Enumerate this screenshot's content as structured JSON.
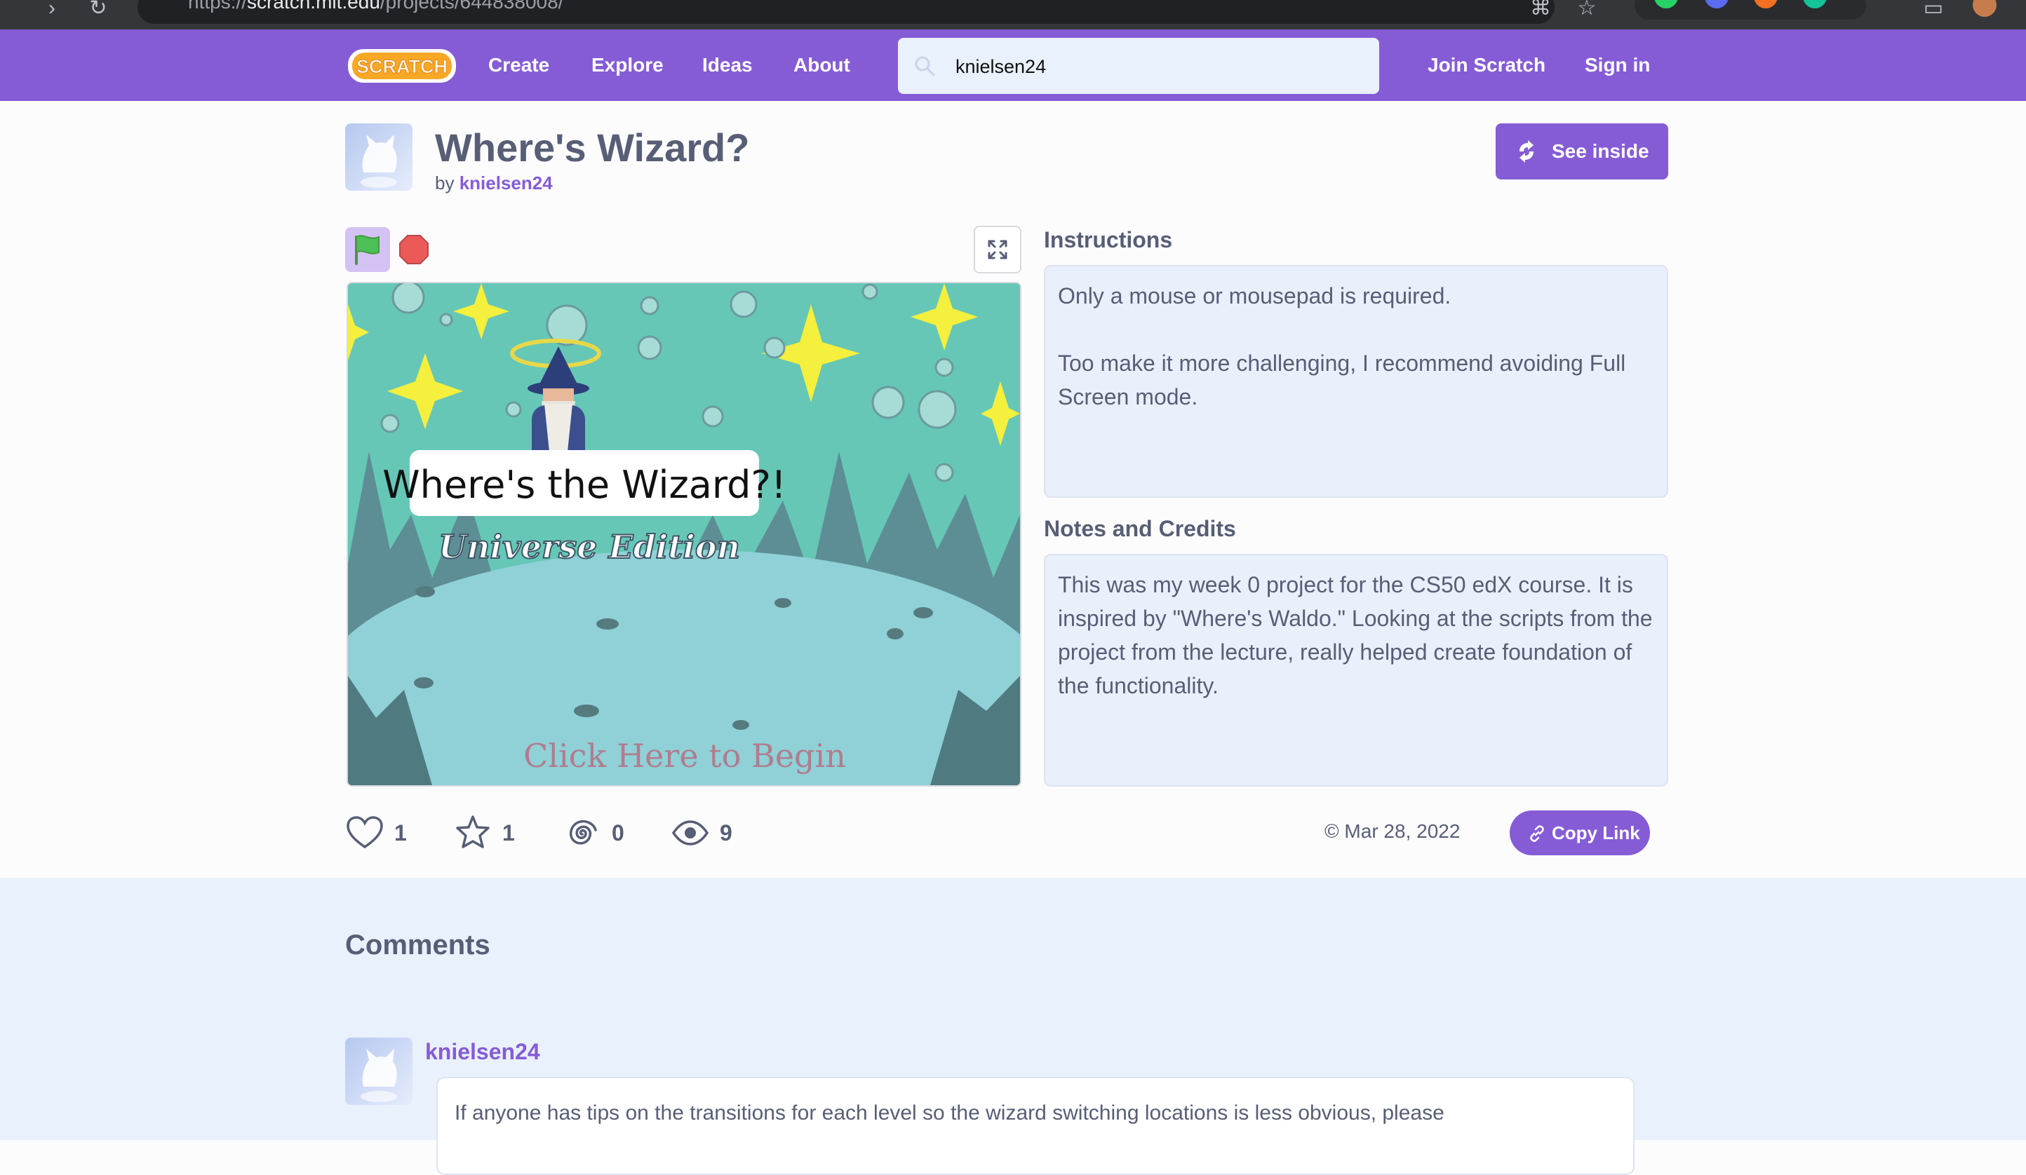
{
  "browser": {
    "url_prefix": "https://",
    "url_host": "scratch.mit.edu",
    "url_path": "/projects/644838008/"
  },
  "menubar": {
    "logo_text": "SCRATCH",
    "links": [
      "Create",
      "Explore",
      "Ideas",
      "About"
    ],
    "search_value": "knielsen24",
    "join_label": "Join Scratch",
    "signin_label": "Sign in",
    "brand_color": "#855cd6"
  },
  "project": {
    "title": "Where's Wizard?",
    "by_label": "by",
    "author": "knielsen24",
    "see_inside_label": "See inside"
  },
  "stage": {
    "title_text": "Where's the Wizard?!",
    "subtitle_text": "Universe Edition",
    "cta_text": "Click Here to Begin"
  },
  "instructions": {
    "heading": "Instructions",
    "paragraphs": [
      "Only a mouse or mousepad is required.",
      "Too make it more challenging, I recommend avoiding Full Screen mode."
    ]
  },
  "notes": {
    "heading": "Notes and Credits",
    "text": "This was my week 0 project for the CS50 edX course. It is inspired by \"Where's Waldo.\" Looking at the scripts from the project from the lecture, really helped create foundation of the functionality."
  },
  "stats": {
    "loves": "1",
    "favorites": "1",
    "remixes": "0",
    "views": "9"
  },
  "date": "Mar 28, 2022",
  "copy_link_label": "Copy Link",
  "comments": {
    "heading": "Comments",
    "items": [
      {
        "user": "knielsen24",
        "text": "If anyone has tips on the transitions for each level so the wizard switching locations is less obvious, please"
      }
    ]
  }
}
